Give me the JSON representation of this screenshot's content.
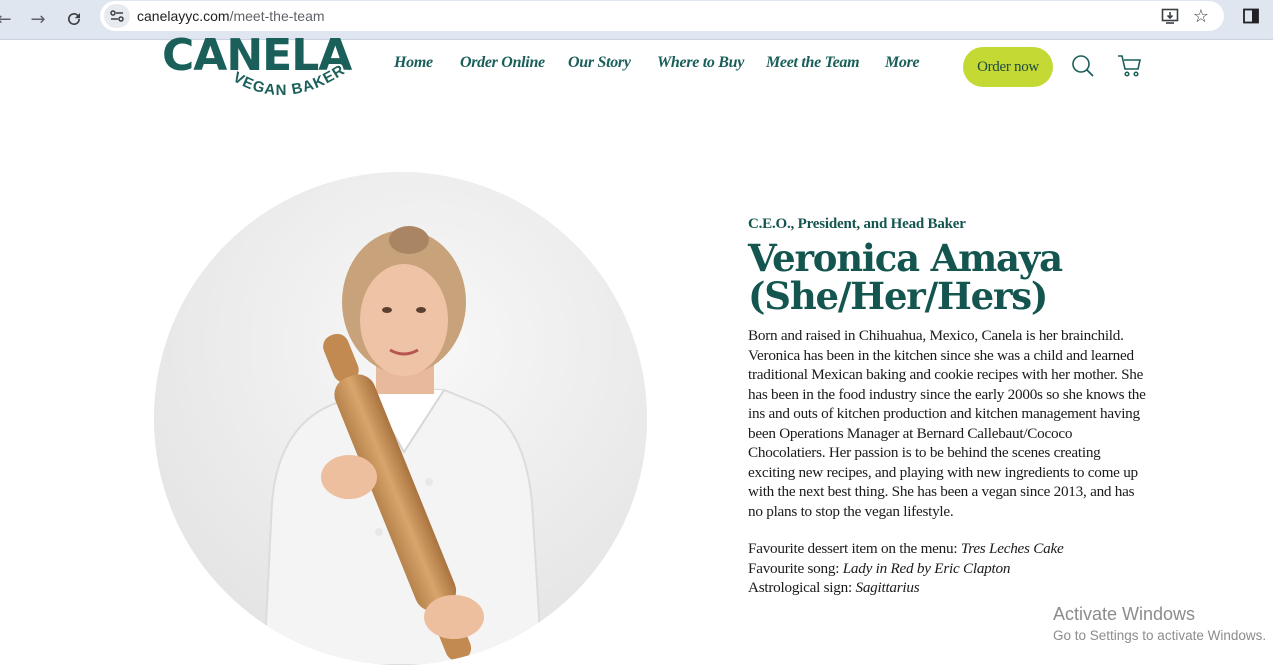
{
  "browser": {
    "url_host": "canelayyc.com",
    "url_path": "/meet-the-team"
  },
  "site": {
    "logo_word": "CANELA",
    "logo_tagline": "VEGAN BAKERY",
    "nav": [
      "Home",
      "Order Online",
      "Our Story",
      "Where to Buy",
      "Meet the Team",
      "More"
    ],
    "order_button": "Order now",
    "icons": [
      "search-icon",
      "cart-icon"
    ]
  },
  "profile": {
    "role": "C.E.O., President, and Head Baker",
    "name_line1": "Veronica Amaya",
    "name_line2": "(She/Her/Hers)",
    "bio": "Born and raised in Chihuahua, Mexico, Canela is her brainchild. Veronica has been in the kitchen since she was a child and learned traditional Mexican baking and cookie recipes with her mother. She has been in the food industry since the early 2000s so she knows the ins and outs of kitchen production and kitchen management having been Operations Manager at Bernard Callebaut/Cococo Chocolatiers. Her passion is to be behind the scenes creating exciting new recipes, and playing with new ingredients to come up with the next best thing. She has been a vegan since 2013, and has no plans to stop the vegan lifestyle.",
    "facts": [
      {
        "label": "Favourite dessert item on the menu: ",
        "value": "Tres Leches Cake"
      },
      {
        "label": "Favourite song: ",
        "value": "Lady in Red by Eric Clapton"
      },
      {
        "label": "Astrological sign: ",
        "value": "Sagittarius"
      }
    ]
  },
  "watermark": {
    "title": "Activate Windows",
    "subtitle": "Go to Settings to activate Windows."
  },
  "colors": {
    "brand_green": "#14564f",
    "button_lime": "#c5d934"
  }
}
